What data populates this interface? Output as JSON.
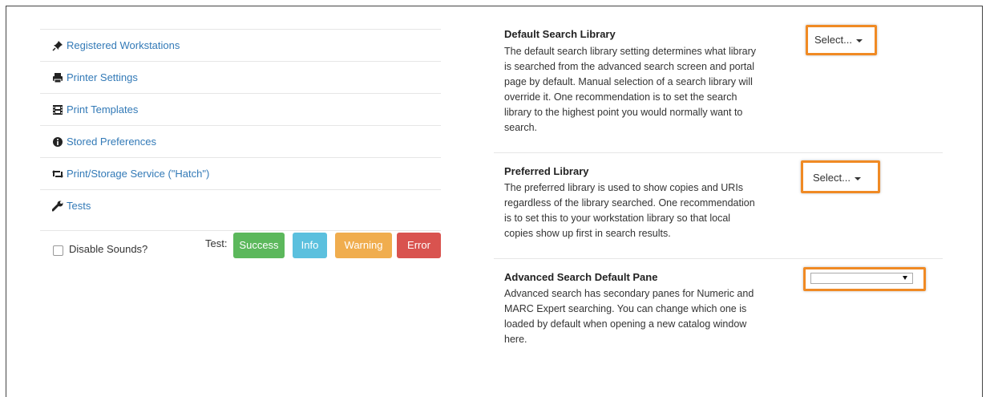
{
  "nav": {
    "items": [
      {
        "label": "Registered Workstations",
        "icon": "pushpin-icon"
      },
      {
        "label": "Printer Settings",
        "icon": "printer-icon"
      },
      {
        "label": "Print Templates",
        "icon": "film-icon"
      },
      {
        "label": "Stored Preferences",
        "icon": "info-circle-icon"
      },
      {
        "label": "Print/Storage Service (\"Hatch\")",
        "icon": "retweet-icon"
      },
      {
        "label": "Tests",
        "icon": "wrench-icon"
      }
    ]
  },
  "sounds": {
    "disable_label": "Disable Sounds?",
    "test_label": "Test:",
    "buttons": {
      "success": "Success",
      "info": "Info",
      "warning": "Warning",
      "error": "Error"
    }
  },
  "settings": [
    {
      "title": "Default Search Library",
      "desc_lines": [
        "The default search library setting determines what library",
        "is searched from the advanced search screen and portal",
        "page by default. Manual selection of a search library will",
        "override it. One recommendation is to set the search",
        "library to the highest point you would normally want to",
        "search."
      ],
      "control": "Select..."
    },
    {
      "title": "Preferred Library",
      "desc_lines": [
        "The preferred library is used to show copies and URIs",
        "regardless of the library searched. One recommendation",
        "is to set this to your workstation library so that local",
        "copies show up first in search results."
      ],
      "control": "Select..."
    },
    {
      "title": "Advanced Search Default Pane",
      "desc_lines": [
        "Advanced search has secondary panes for Numeric and",
        "MARC Expert searching. You can change which one is",
        "loaded by default when opening a new catalog window",
        "here."
      ],
      "control": ""
    }
  ],
  "colors": {
    "highlight": "#f08a24",
    "link": "#337ab7",
    "success": "#5cb85c",
    "info": "#5bc0de",
    "warning": "#f0ad4e",
    "error": "#d9534f"
  }
}
